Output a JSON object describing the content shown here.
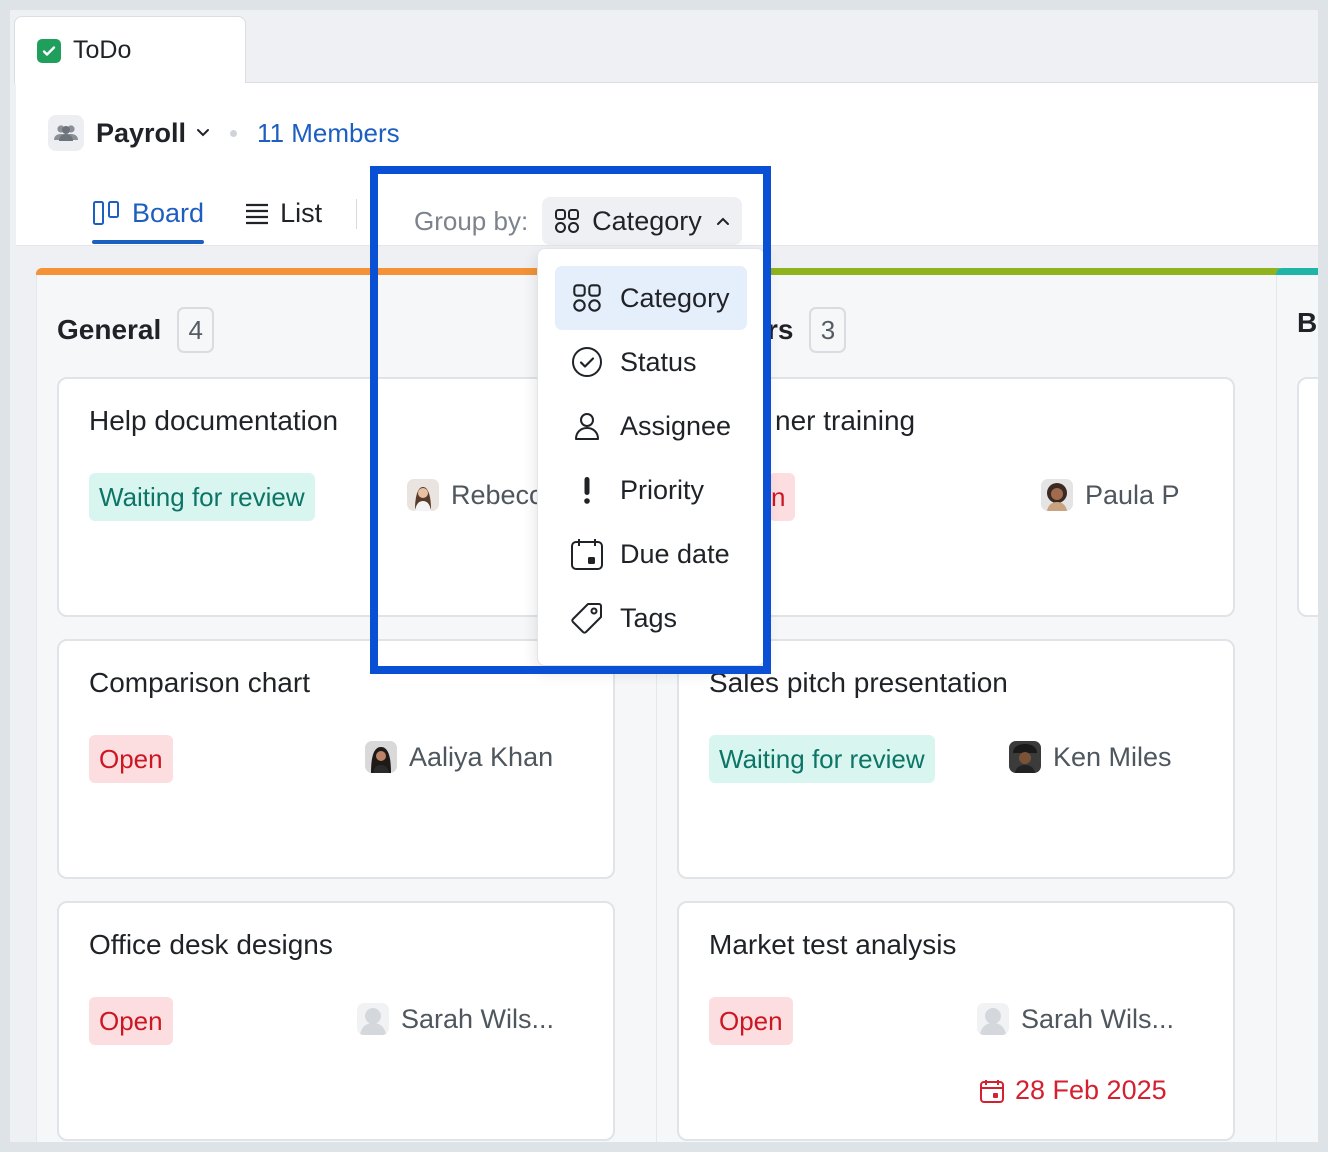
{
  "tab": {
    "label": "ToDo"
  },
  "header": {
    "project_name": "Payroll",
    "members": "11 Members"
  },
  "view_tabs": [
    {
      "label": "Board",
      "active": true
    },
    {
      "label": "List",
      "active": false
    }
  ],
  "group_by": {
    "label": "Group by:",
    "value": "Category"
  },
  "menu": {
    "items": [
      {
        "label": "Category",
        "icon": "category-icon",
        "selected": true
      },
      {
        "label": "Status",
        "icon": "check-circle-icon"
      },
      {
        "label": "Assignee",
        "icon": "user-icon"
      },
      {
        "label": "Priority",
        "icon": "exclamation-icon"
      },
      {
        "label": "Due date",
        "icon": "calendar-icon"
      },
      {
        "label": "Tags",
        "icon": "tag-icon"
      }
    ]
  },
  "columns": [
    {
      "name": "General",
      "count": "4",
      "color": "#f39237",
      "cards": [
        {
          "title": "Help documentation",
          "status": "Waiting for review",
          "assignee": "Rebecca"
        },
        {
          "title": "Comparison chart",
          "status": "Open",
          "assignee": "Aaliya Khan"
        },
        {
          "title": "Office desk designs",
          "status": "Open",
          "assignee": "Sarah Wils..."
        }
      ]
    },
    {
      "name": "rs",
      "count": "3",
      "color": "#8fb31d",
      "cards": [
        {
          "title": "ner training",
          "status": "n",
          "assignee": "Paula P"
        },
        {
          "title": "Sales pitch presentation",
          "status": "Waiting for review",
          "assignee": "Ken Miles"
        },
        {
          "title": "Market test analysis",
          "status": "Open",
          "assignee": "Sarah Wils...",
          "due": "28 Feb 2025"
        }
      ]
    },
    {
      "name": "Bl",
      "color": "#1fb5a6"
    }
  ],
  "colors": {
    "accent": "#1d5fc0",
    "highlight_frame": "#0a50d4",
    "open": "#cc1722",
    "review": "#0c7566"
  }
}
